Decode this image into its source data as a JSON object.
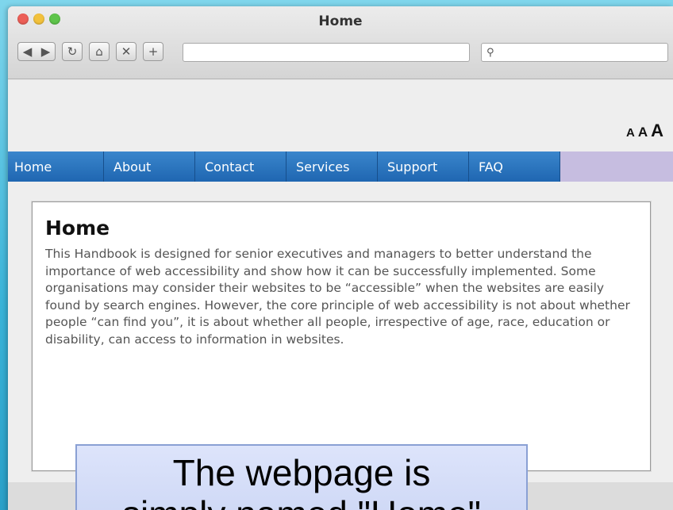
{
  "window": {
    "title": "Home"
  },
  "toolbar": {
    "back_icon": "back-arrow-icon",
    "forward_icon": "forward-arrow-icon",
    "reload_icon": "reload-icon",
    "home_icon": "home-icon",
    "stop_icon": "stop-icon",
    "add_icon": "add-bookmark-icon",
    "url_value": "",
    "search_value": ""
  },
  "text_size": {
    "small": "A",
    "medium": "A",
    "large": "A"
  },
  "nav": {
    "items": [
      {
        "label": "Home"
      },
      {
        "label": "About"
      },
      {
        "label": "Contact"
      },
      {
        "label": "Services"
      },
      {
        "label": "Support"
      },
      {
        "label": "FAQ"
      }
    ]
  },
  "main": {
    "heading": "Home",
    "body": "This Handbook is designed for senior executives and managers to better understand the importance of web accessibility and show how it can be successfully implemented. Some organisations may consider their websites to be “accessible” when the websites are easily found by search engines. However, the core principle of web accessibility is not about whether people “can find you”, it is about whether all people, irrespective of age, race, education or disability, can access to information in websites."
  },
  "callout": {
    "line1": "The webpage is",
    "line2": "simply named \"Home\""
  },
  "colors": {
    "nav_blue": "#1f66b1",
    "nav_bg": "#c6bde0",
    "callout_bg": "#cdd7f5"
  }
}
